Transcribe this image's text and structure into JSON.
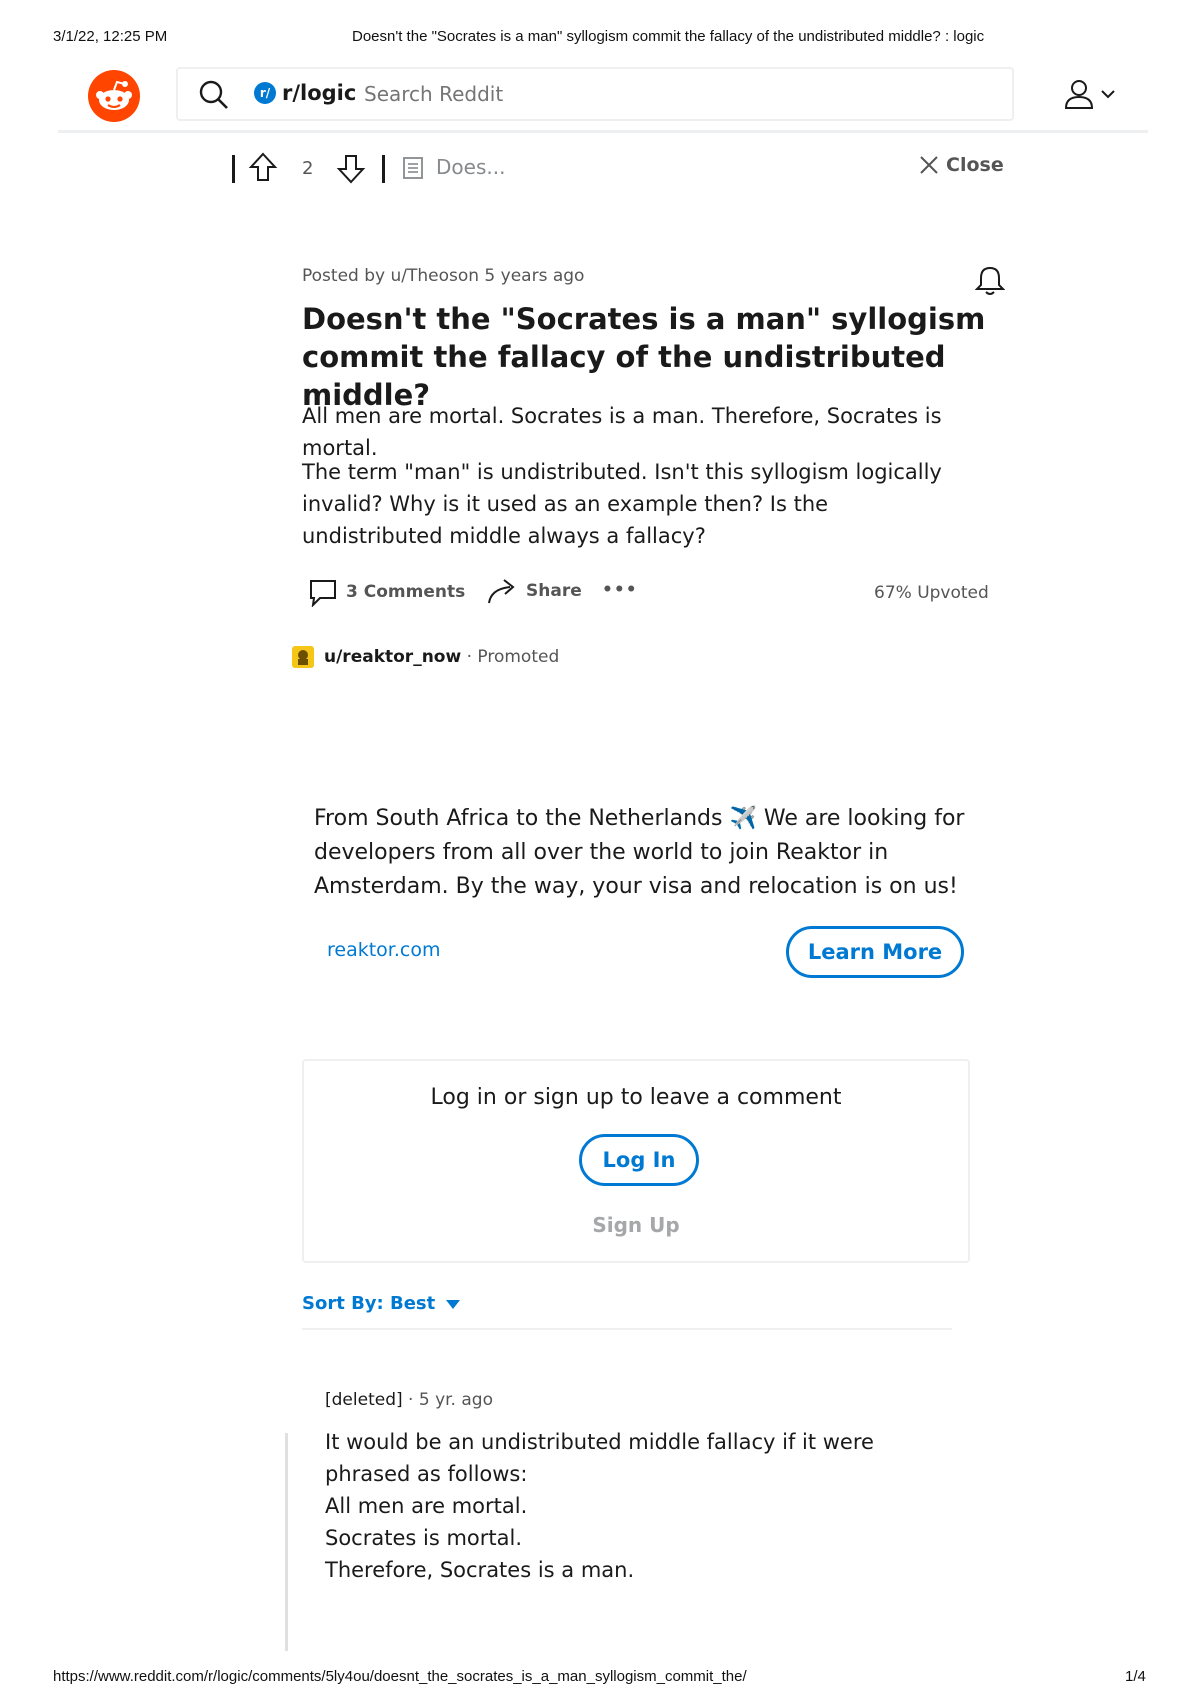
{
  "print": {
    "datetime": "3/1/22, 12:25 PM",
    "doc_title": "Doesn't the \"Socrates is a man\" syllogism commit the fallacy of the undistributed middle? : logic",
    "url": "https://www.reddit.com/r/logic/comments/5ly4ou/doesnt_the_socrates_is_a_man_syllogism_commit_the/",
    "page": "1/4"
  },
  "header": {
    "subreddit": "r/logic",
    "subreddit_chip": "r/",
    "search_placeholder": "Search Reddit"
  },
  "post_bar": {
    "vote_count": "2",
    "short_title": "Does...",
    "close_label": "Close"
  },
  "post": {
    "meta": "Posted by u/Theoson 5 years ago",
    "title": "Doesn't the \"Socrates is a man\" syllogism commit the fallacy of the undistributed middle?",
    "body_p1": "All men are mortal. Socrates is a man. Therefore, Socrates is mortal.",
    "body_p2": "The term \"man\" is undistributed. Isn't this syllogism logically invalid? Why is it used as an example then? Is the undistributed middle always a fallacy?",
    "comments_label": "3 Comments",
    "share_label": "Share",
    "more_label": "•••",
    "upvoted": "67% Upvoted"
  },
  "ad": {
    "user": "u/reaktor_now",
    "promoted": "Promoted",
    "text_before": "From South Africa to the Netherlands ",
    "text_emoji": "✈️",
    "text_after": " We are looking for developers from all over the world to join Reaktor in Amsterdam. By the way, your visa and relocation is on us!",
    "domain": "reaktor.com",
    "cta": "Learn More"
  },
  "login": {
    "prompt": "Log in or sign up to leave a comment",
    "login_label": "Log In",
    "signup_label": "Sign Up"
  },
  "sort": {
    "label": "Sort By: Best"
  },
  "comment": {
    "author": "[deleted]",
    "time": "5 yr. ago",
    "lines": [
      "It would be an undistributed middle fallacy if it were phrased as follows:",
      "All men are mortal.",
      "Socrates is mortal.",
      "Therefore, Socrates is a man."
    ]
  },
  "colors": {
    "brand": "#ff4500",
    "link_blue": "#0079d3",
    "muted": "#878a8c",
    "border": "#edeff1"
  }
}
